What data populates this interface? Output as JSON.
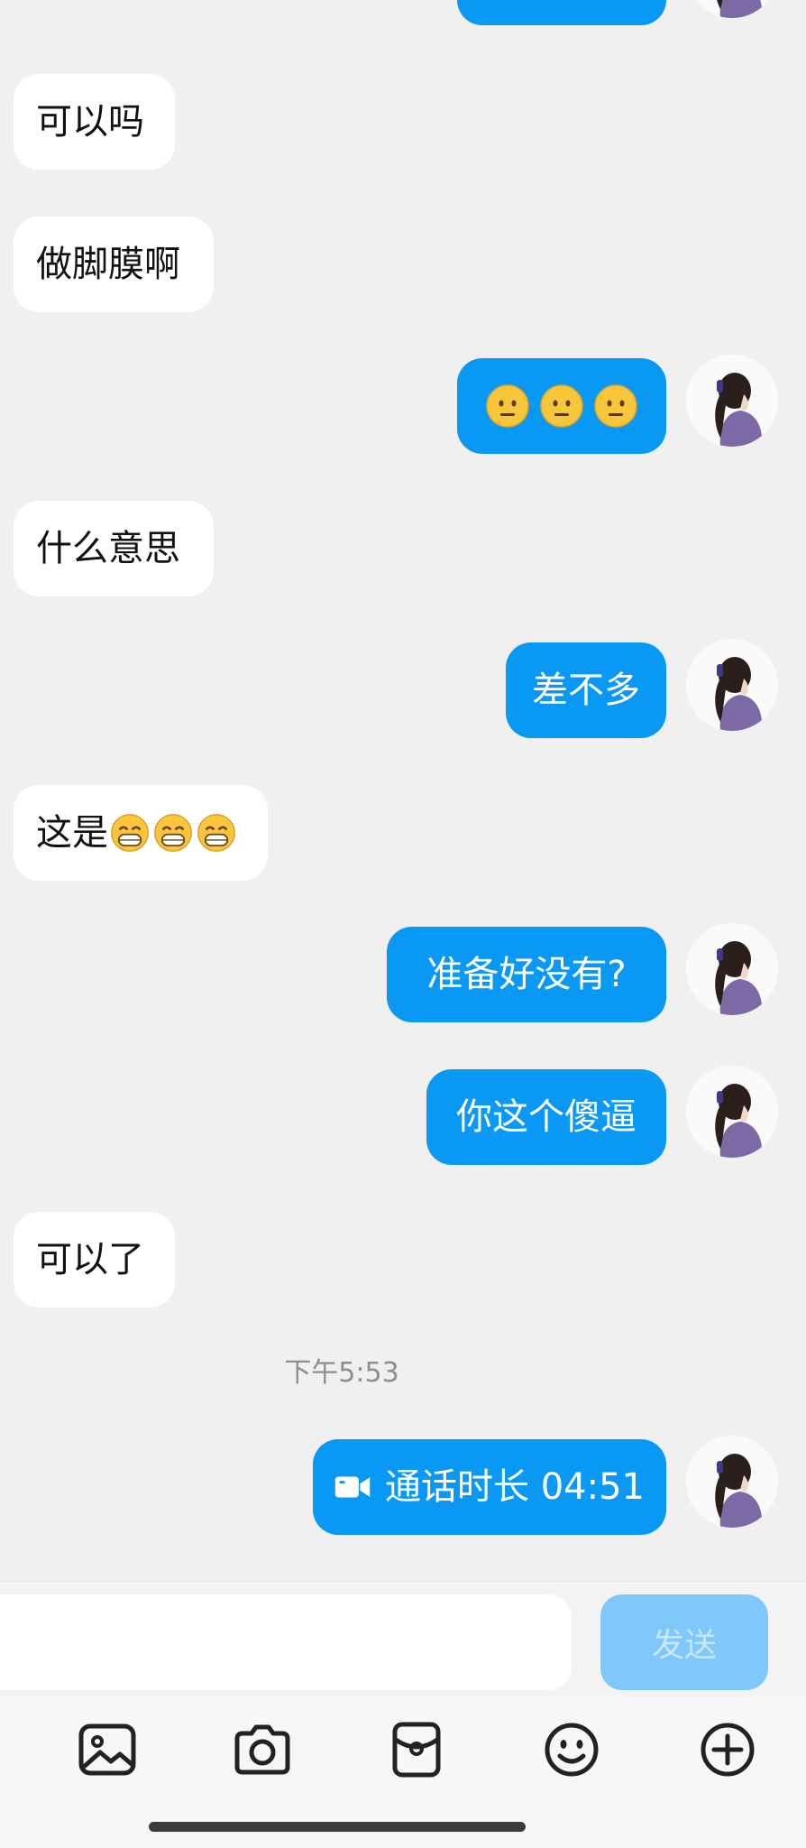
{
  "messages": [
    {
      "side": "in",
      "text": "可以吗"
    },
    {
      "side": "in",
      "text": "做脚膜啊"
    },
    {
      "side": "out",
      "emojis": [
        "neutral-face-emoji",
        "neutral-face-emoji",
        "neutral-face-emoji"
      ]
    },
    {
      "side": "in",
      "text": "什么意思"
    },
    {
      "side": "out",
      "text": "差不多"
    },
    {
      "side": "in",
      "text": "这是",
      "emojis": [
        "grinning-face-emoji",
        "grinning-face-emoji",
        "grinning-face-emoji"
      ]
    },
    {
      "side": "out",
      "text": "准备好没有?"
    },
    {
      "side": "out",
      "text": "你这个傻逼"
    },
    {
      "side": "in",
      "text": "可以了"
    }
  ],
  "timestamp": "下午5:53",
  "call": {
    "label": "通话时长 04:51",
    "icon": "video-call-icon"
  },
  "input": {
    "placeholder": ""
  },
  "send_label": "发送",
  "toolbar": [
    "image-icon",
    "camera-icon",
    "red-packet-icon",
    "emoji-icon",
    "plus-icon"
  ],
  "colors": {
    "outgoing_bubble": "#0a98f5",
    "incoming_bubble": "#ffffff",
    "background": "#f0f0f0",
    "send_disabled": "#80c8f9"
  }
}
